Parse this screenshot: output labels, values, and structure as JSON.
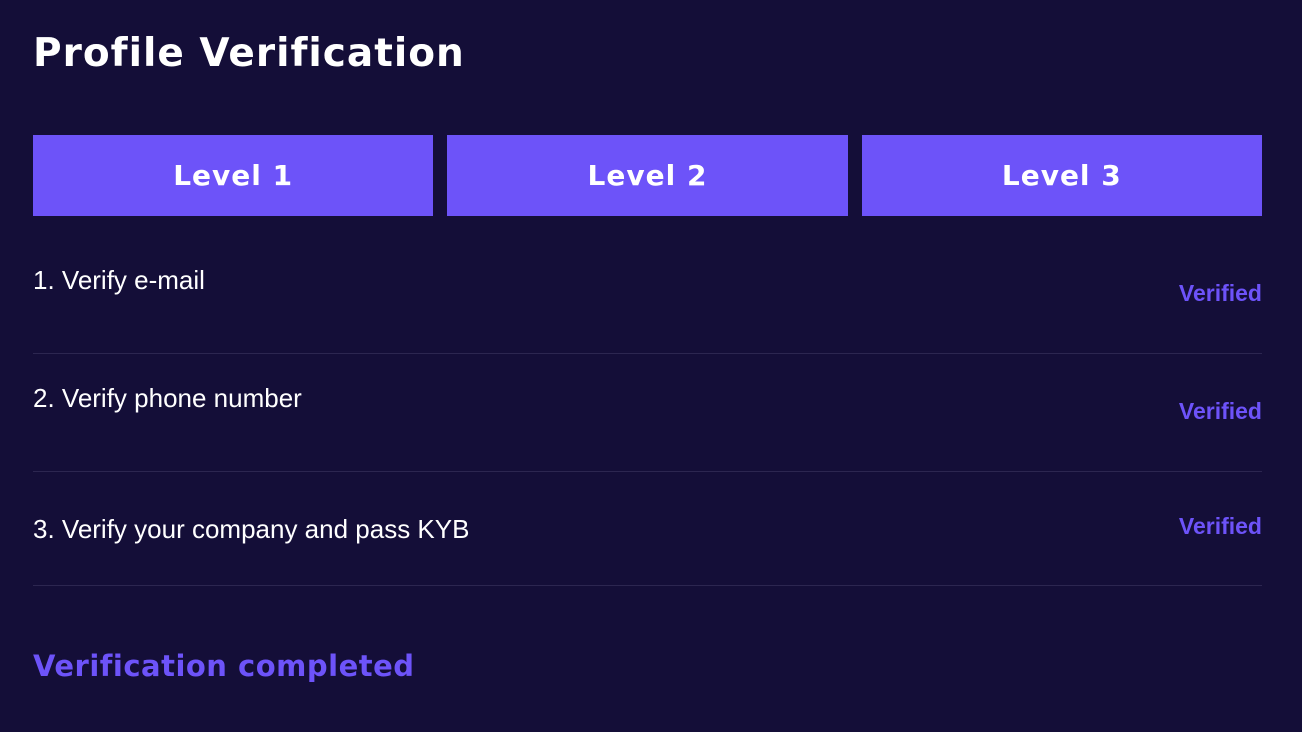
{
  "page": {
    "title": "Profile Verification",
    "completed_text": "Verification completed"
  },
  "levels": [
    {
      "label": "Level 1"
    },
    {
      "label": "Level 2"
    },
    {
      "label": "Level 3"
    }
  ],
  "steps": [
    {
      "label": "1. Verify e-mail",
      "status": "Verified"
    },
    {
      "label": "2. Verify phone number",
      "status": "Verified"
    },
    {
      "label": "3. Verify your company and pass KYB",
      "status": "Verified"
    }
  ],
  "colors": {
    "background": "#140e38",
    "accent": "#6d53f9",
    "divider": "#2c2650",
    "text": "#ffffff"
  }
}
